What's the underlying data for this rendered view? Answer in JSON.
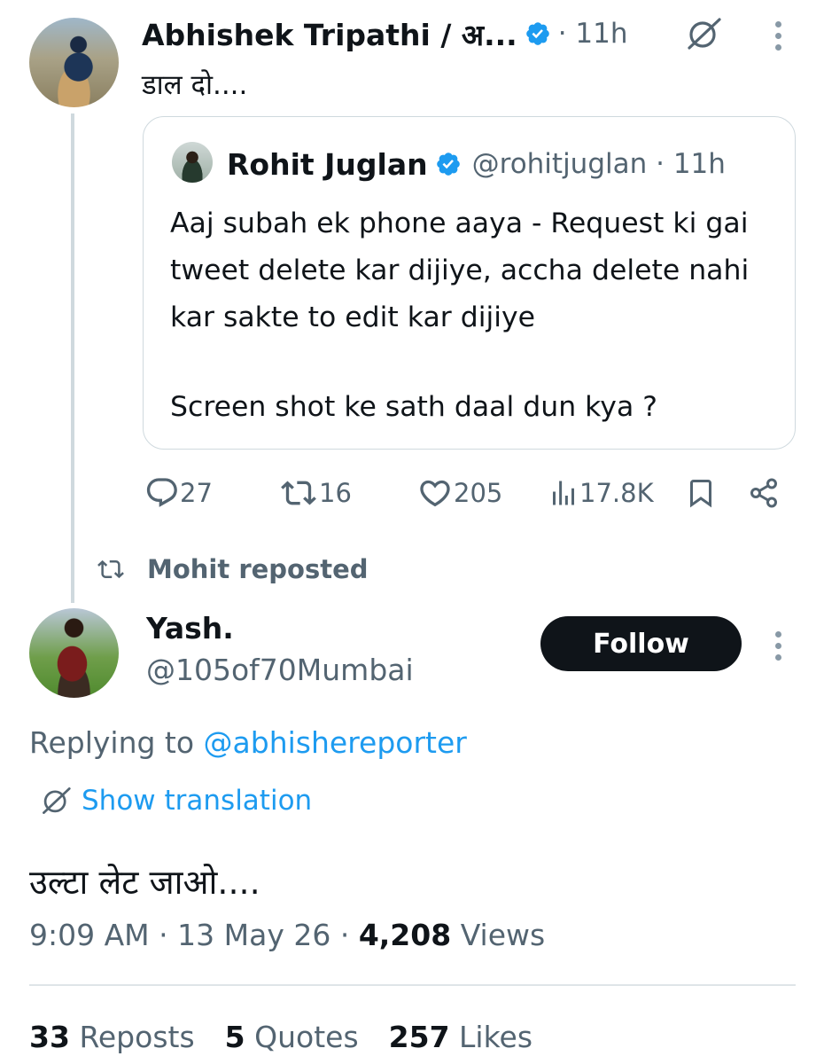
{
  "colors": {
    "accent": "#1d9bf0",
    "text": "#0f1419",
    "muted": "#536471",
    "border": "#cfd9de",
    "follow_bg": "#0f1419"
  },
  "parent_tweet": {
    "display_name": "Abhishek Tripathi / अ...",
    "time": "· 11h",
    "text": "डाल दो....",
    "quoted": {
      "display_name": "Rohit Juglan",
      "handle_time": "@rohitjuglan · 11h",
      "line1": "Aaj subah ek phone aaya - Request ki gai tweet delete kar dijiye,  accha delete nahi kar sakte to edit kar dijiye",
      "line2": "Screen shot ke sath daal dun kya ?"
    },
    "actions": {
      "replies": "27",
      "reposts": "16",
      "likes": "205",
      "views": "17.8K"
    }
  },
  "repost_banner": "Mohit reposted",
  "main_tweet": {
    "display_name": "Yash.",
    "handle": "@105of70Mumbai",
    "follow_label": "Follow",
    "replying_prefix": "Replying to ",
    "replying_mention": "@abhishereporter",
    "show_translation": "Show translation",
    "text": "उल्टा लेट जाओ....",
    "time": "9:09 AM",
    "date": "13 May 26",
    "views_count": "4,208",
    "views_label": "Views",
    "reposts_count": "33",
    "reposts_label": "Reposts",
    "quotes_count": "5",
    "quotes_label": "Quotes",
    "likes_count": "257",
    "likes_label": "Likes"
  },
  "icons": {
    "verified": "verified-badge-icon",
    "translate": "translate-icon",
    "more": "more-vertical-icon",
    "reply": "reply-icon",
    "repost": "repost-icon",
    "like": "heart-icon",
    "views": "views-chart-icon",
    "bookmark": "bookmark-icon",
    "share": "share-icon"
  }
}
